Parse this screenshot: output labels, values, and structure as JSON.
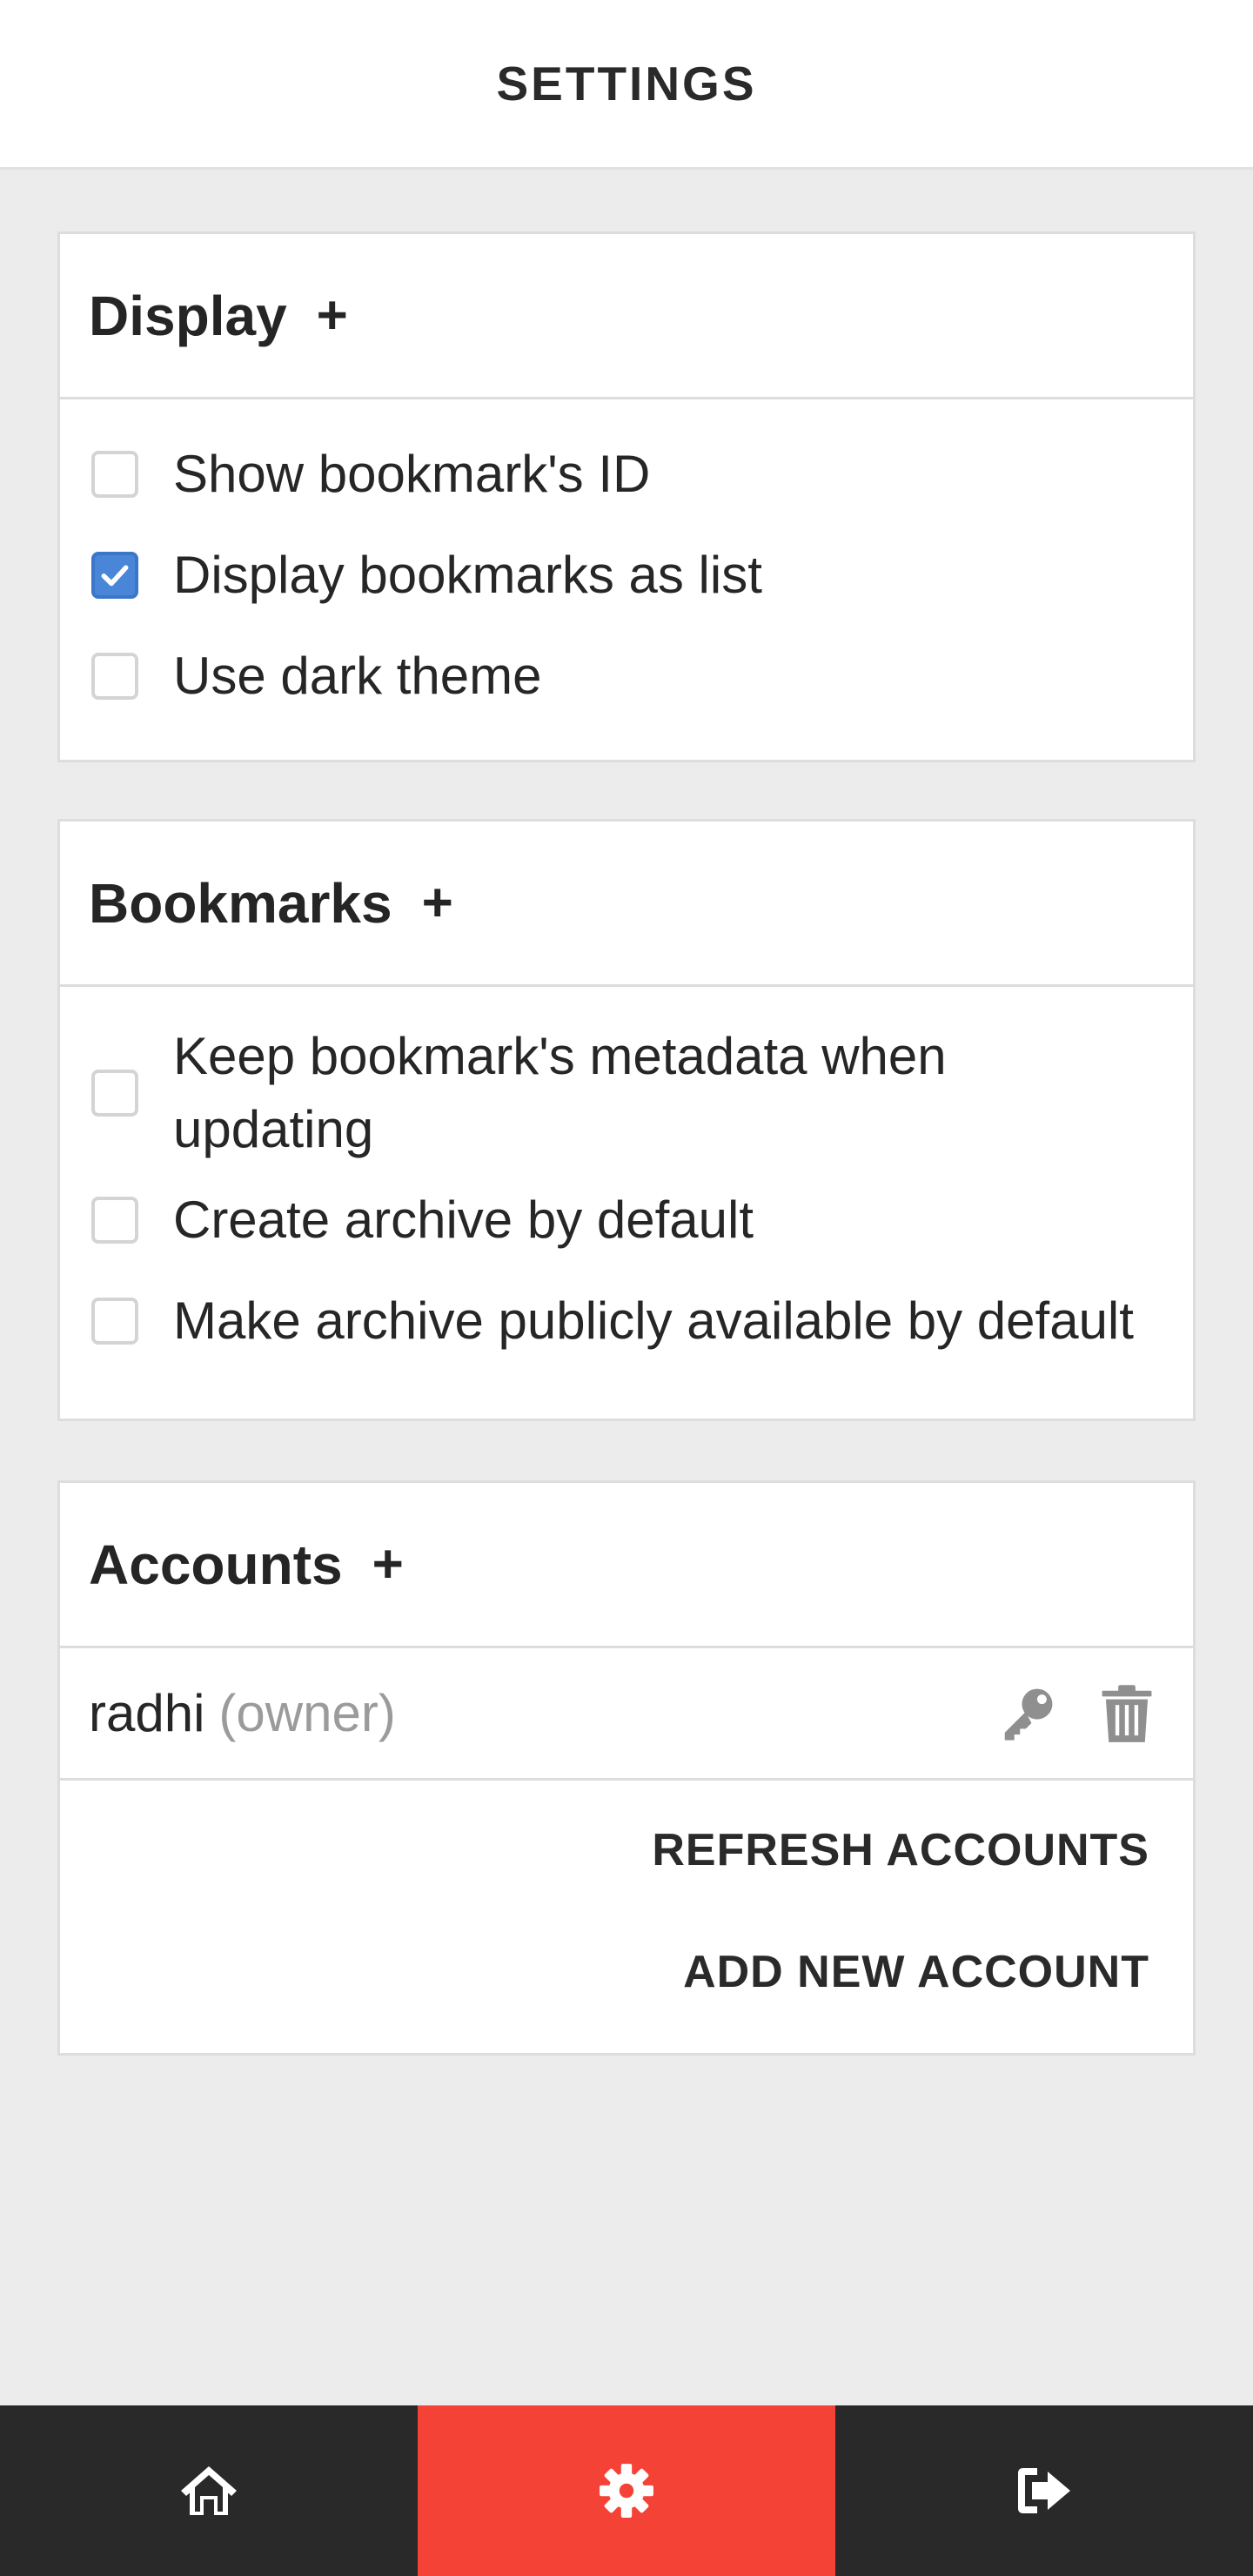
{
  "header": {
    "title": "SETTINGS"
  },
  "display": {
    "title": "Display",
    "toggle": "+",
    "options": [
      {
        "label": "Show bookmark's ID",
        "checked": false
      },
      {
        "label": "Display bookmarks as list",
        "checked": true
      },
      {
        "label": "Use dark theme",
        "checked": false
      }
    ]
  },
  "bookmarks": {
    "title": "Bookmarks",
    "toggle": "+",
    "options": [
      {
        "label": "Keep bookmark's metadata when updating",
        "checked": false
      },
      {
        "label": "Create archive by default",
        "checked": false
      },
      {
        "label": "Make archive publicly available by default",
        "checked": false
      }
    ]
  },
  "accounts": {
    "title": "Accounts",
    "toggle": "+",
    "users": [
      {
        "name": "radhi",
        "role": "(owner)",
        "actions": [
          "key-icon",
          "trash-icon"
        ]
      }
    ],
    "refresh_label": "REFRESH ACCOUNTS",
    "add_label": "ADD NEW ACCOUNT"
  },
  "bottom_nav": {
    "items": [
      {
        "icon": "home-icon",
        "active": false
      },
      {
        "icon": "gear-icon",
        "active": true
      },
      {
        "icon": "logout-icon",
        "active": false
      }
    ],
    "active_color": "#f44336",
    "bar_color": "#292929"
  },
  "colors": {
    "checkbox_checked": "#4a86d8",
    "background": "#ececec"
  }
}
